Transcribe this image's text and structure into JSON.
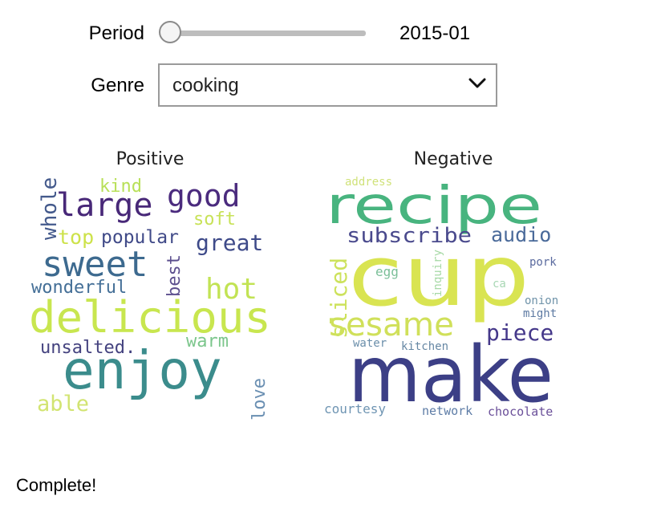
{
  "controls": {
    "period_label": "Period",
    "period_value": "2015-01",
    "period_slider_level": 0,
    "genre_label": "Genre",
    "genre_value": "cooking"
  },
  "clouds": {
    "positive": {
      "title": "Positive",
      "words": [
        {
          "text": "enjoy",
          "color": "#3b8c8c"
        },
        {
          "text": "delicious",
          "color": "#c8e64f"
        },
        {
          "text": "sweet",
          "color": "#3d6a8f"
        },
        {
          "text": "large",
          "color": "#482878"
        },
        {
          "text": "good",
          "color": "#4b2b7e"
        },
        {
          "text": "hot",
          "color": "#c2e354"
        },
        {
          "text": "great",
          "color": "#3e4a89"
        },
        {
          "text": "popular",
          "color": "#404a88"
        },
        {
          "text": "top",
          "color": "#cde24a"
        },
        {
          "text": "wonderful",
          "color": "#446f97"
        },
        {
          "text": "kind",
          "color": "#b8e058"
        },
        {
          "text": "soft",
          "color": "#c8e258"
        },
        {
          "text": "whole",
          "color": "#445a8c"
        },
        {
          "text": "best",
          "color": "#5c4f8e"
        },
        {
          "text": "unsalted.",
          "color": "#44427f"
        },
        {
          "text": "warm",
          "color": "#7cc68c"
        },
        {
          "text": "able",
          "color": "#d2e472"
        },
        {
          "text": "love",
          "color": "#6a8fb2"
        }
      ]
    },
    "negative": {
      "title": "Negative",
      "words": [
        {
          "text": "cup",
          "color": "#d9e452"
        },
        {
          "text": "make",
          "color": "#3c3f86"
        },
        {
          "text": "recipe",
          "color": "#48b47f"
        },
        {
          "text": "sesame",
          "color": "#d0e05a"
        },
        {
          "text": "subscribe",
          "color": "#4a4a8d"
        },
        {
          "text": "audio",
          "color": "#4a6a9a"
        },
        {
          "text": "piece",
          "color": "#45388a"
        },
        {
          "text": "sliced",
          "color": "#cde25c"
        },
        {
          "text": "address",
          "color": "#d0e27a"
        },
        {
          "text": "egg",
          "color": "#7abf98"
        },
        {
          "text": "inquiry",
          "color": "#a7d9a6"
        },
        {
          "text": "pork",
          "color": "#5a6a9e"
        },
        {
          "text": "ca",
          "color": "#a8d7b4"
        },
        {
          "text": "onion",
          "color": "#6f93a9"
        },
        {
          "text": "might",
          "color": "#5d7aa2"
        },
        {
          "text": "water",
          "color": "#6a8eaa"
        },
        {
          "text": "kitchen",
          "color": "#6687a4"
        },
        {
          "text": "courtesy",
          "color": "#6f95b3"
        },
        {
          "text": "network",
          "color": "#5d7ca6"
        },
        {
          "text": "chocolate",
          "color": "#6a4f99"
        }
      ]
    }
  },
  "status": "Complete!"
}
